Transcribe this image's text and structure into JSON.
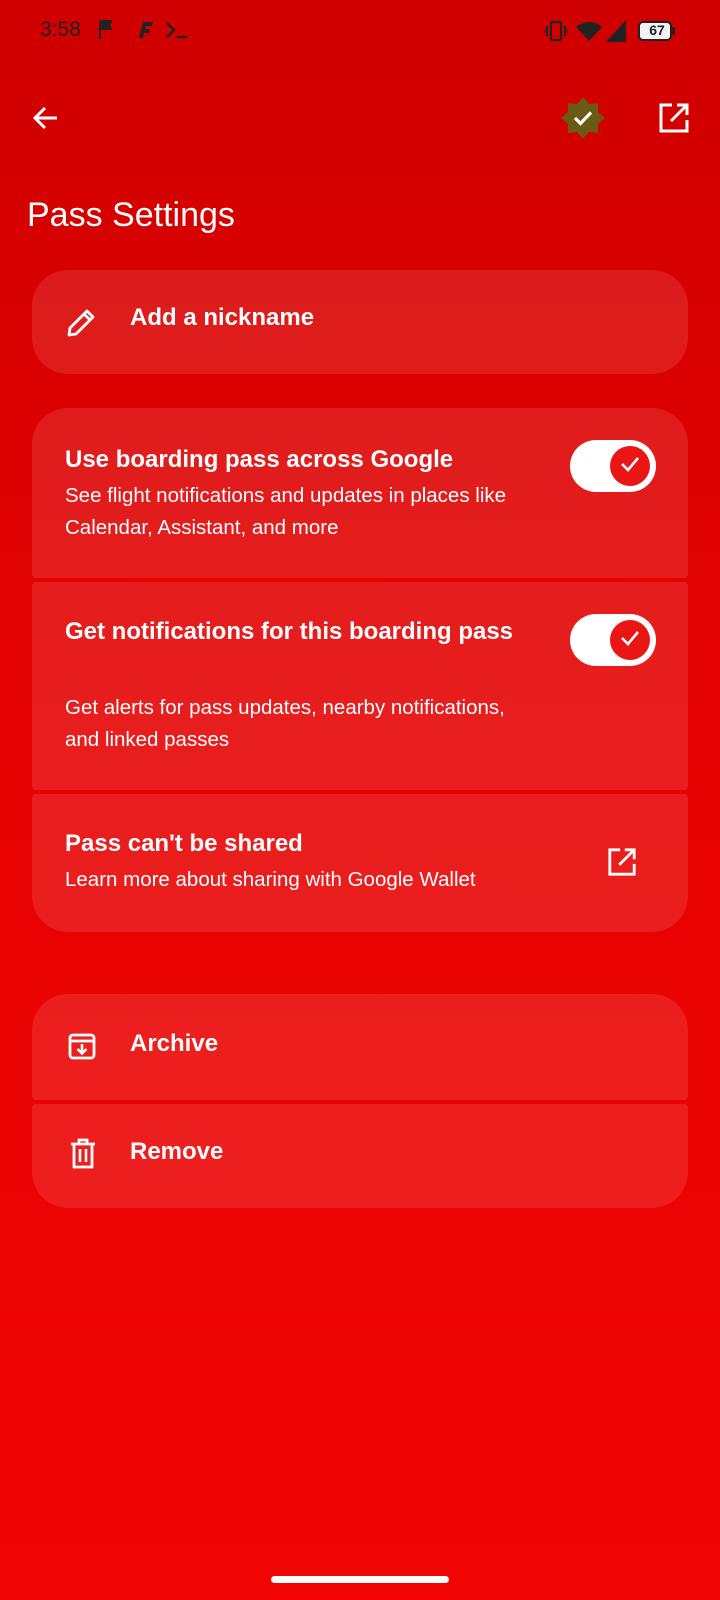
{
  "status_bar": {
    "time": "3:58",
    "battery": "67",
    "icons": [
      "flag-icon",
      "app-f-icon",
      "terminal-icon",
      "vibrate-icon",
      "wifi-icon",
      "signal-icon",
      "battery-icon"
    ]
  },
  "app_bar": {
    "back_icon": "arrow-back-icon",
    "badge_icon": "verified-star-badge-icon",
    "open_icon": "open-in-new-icon"
  },
  "page": {
    "title": "Pass Settings"
  },
  "nickname": {
    "label": "Add a nickname",
    "icon": "pencil-icon"
  },
  "settings": {
    "boarding_pass": {
      "title": "Use boarding pass across Google",
      "subtitle": "See flight notifications and updates in places like Calendar, Assistant, and more",
      "enabled": true
    },
    "notifications": {
      "title": "Get notifications for this boarding pass",
      "subtitle": "Get alerts for pass updates, nearby notifications, and linked passes",
      "enabled": true
    },
    "sharing": {
      "title": "Pass can't be shared",
      "subtitle": "Learn more about sharing with Google Wallet",
      "icon": "open-in-new-icon"
    }
  },
  "actions": {
    "archive": {
      "label": "Archive",
      "icon": "archive-icon"
    },
    "remove": {
      "label": "Remove",
      "icon": "trash-icon"
    }
  },
  "colors": {
    "background_top": "#cf0000",
    "background_bottom": "#f00404",
    "toggle_thumb": "#ea1515",
    "badge": "#6b5a14"
  }
}
